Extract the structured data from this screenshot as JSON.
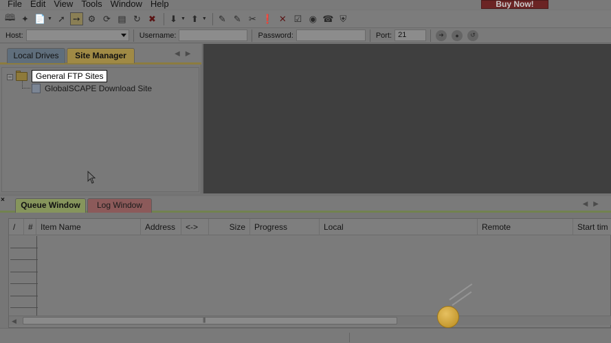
{
  "menu": {
    "items": [
      "File",
      "Edit",
      "View",
      "Tools",
      "Window",
      "Help"
    ],
    "buy_now": "Buy Now!"
  },
  "toolbar": {
    "icons": [
      "open-icon",
      "wand-icon",
      "new-site-icon",
      "connect-icon",
      "disconnect-icon",
      "pointer-icon",
      "transfer-icon",
      "sync-icon",
      "archive-icon",
      "refresh-icon",
      "stop-icon",
      "download-icon",
      "upload-icon",
      "properties-icon",
      "edit-icon",
      "cut-icon",
      "notify-icon",
      "delete-icon",
      "check-icon",
      "globe-icon",
      "support-icon",
      "shield-icon"
    ]
  },
  "connect_bar": {
    "host_label": "Host:",
    "host_value": "",
    "username_label": "Username:",
    "username_value": "",
    "password_label": "Password:",
    "password_value": "",
    "port_label": "Port:",
    "port_value": "21"
  },
  "left_panel": {
    "tabs": [
      "Local Drives",
      "Site Manager"
    ],
    "active_tab": "Site Manager",
    "tree": {
      "folder_label": "General FTP Sites",
      "site_label": "GlobalSCAPE Download Site"
    }
  },
  "bottom_panel": {
    "close_glyph": "×",
    "tabs": [
      "Queue Window",
      "Log Window"
    ],
    "active_tab": "Queue Window",
    "columns": [
      "/",
      "#",
      "Item Name",
      "Address",
      "<->",
      "Size",
      "Progress",
      "Local",
      "Remote",
      "Start tim"
    ],
    "row_count": 7
  },
  "colors": {
    "site_manager_tab": "#a08a45",
    "queue_tab": "#86955c",
    "log_tab": "#8c5a5a",
    "buy_now": "#6b2424"
  }
}
